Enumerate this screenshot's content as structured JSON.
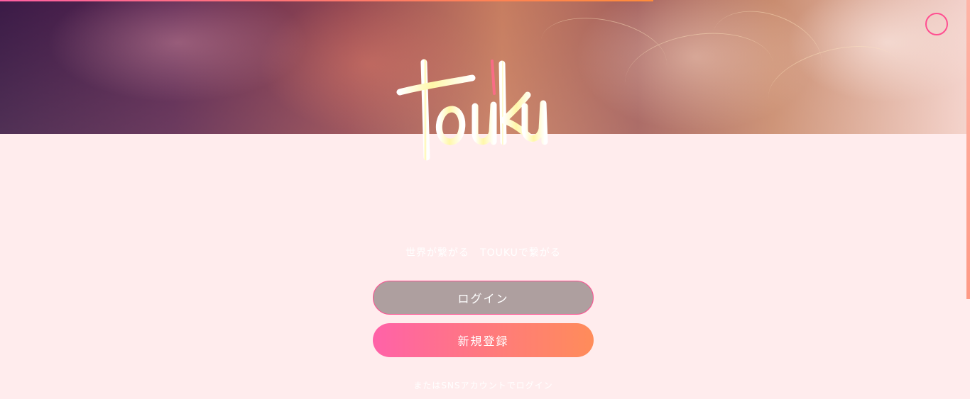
{
  "app": {
    "logo_text": "touku",
    "tagline": "世界が繋がる　TOUKUで繋がる"
  },
  "actions": {
    "login_label": "ログイン",
    "register_label": "新規登録",
    "sns_login_label": "またはSNSアカウントでログイン"
  },
  "header": {
    "menu_icon": "circle-menu-icon"
  },
  "colors": {
    "background": "#ffeced",
    "accent_pink": "#ff4f91",
    "login_button": "#ae9f9f",
    "register_gradient_start": "#ff62a8",
    "register_gradient_end": "#ff8c5a",
    "text_light": "#ffffff"
  }
}
